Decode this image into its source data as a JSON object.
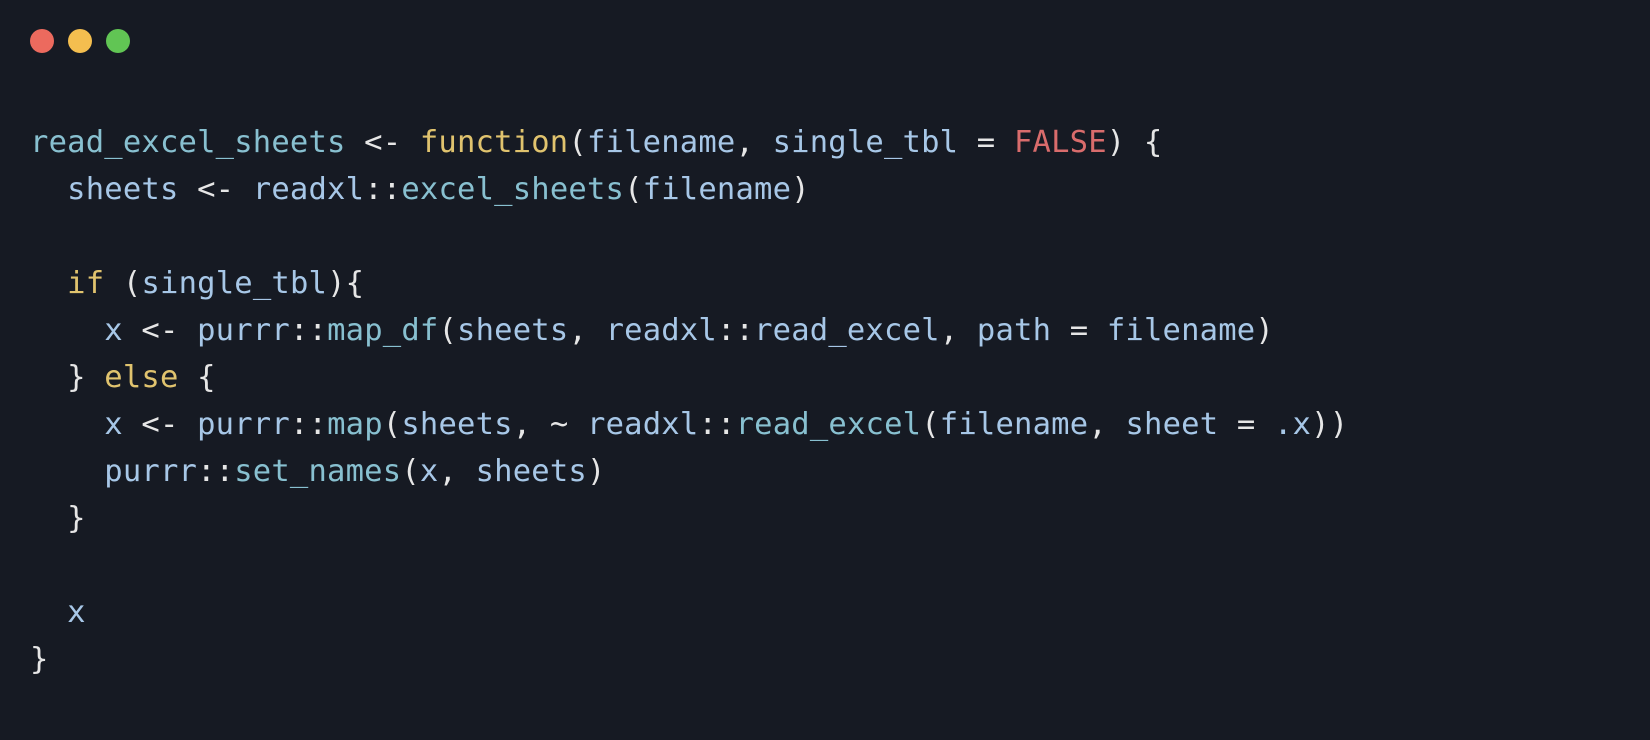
{
  "window_controls": {
    "close_color": "#ec6a5e",
    "min_color": "#f4be4f",
    "max_color": "#61c554"
  },
  "syntax_colors": {
    "bg": "#161a23",
    "fn": "#88c0d0",
    "kw": "#e0c36e",
    "id": "#a7c7e7",
    "op": "#e6e6e6",
    "bool": "#d96c6c"
  },
  "code": {
    "l1": {
      "fn_name": "read_excel_sheets",
      "assign": " <- ",
      "kw_function": "function",
      "lp": "(",
      "p1": "filename",
      "comma1": ", ",
      "p2": "single_tbl",
      "eq": " = ",
      "false": "FALSE",
      "rp_brace": ") {"
    },
    "l2": {
      "indent": "  ",
      "lhs": "sheets",
      "assign": " <- ",
      "pkg": "readxl",
      "dcolon": "::",
      "call": "excel_sheets",
      "lp": "(",
      "arg": "filename",
      "rp": ")"
    },
    "l3": "",
    "l4": {
      "indent": "  ",
      "kw_if": "if",
      "sp": " ",
      "lp": "(",
      "cond": "single_tbl",
      "rp_brace": "){"
    },
    "l5": {
      "indent": "    ",
      "lhs": "x",
      "assign": " <- ",
      "pkg": "purrr",
      "dcolon": "::",
      "call": "map_df",
      "lp": "(",
      "a1": "sheets",
      "c1": ", ",
      "pkg2": "readxl",
      "dcolon2": "::",
      "a2": "read_excel",
      "c2": ", ",
      "kw_path": "path",
      "eq": " = ",
      "a3": "filename",
      "rp": ")"
    },
    "l6": {
      "indent": "  ",
      "close": "}",
      "sp": " ",
      "kw_else": "else",
      "sp2": " ",
      "open": "{"
    },
    "l7": {
      "indent": "    ",
      "lhs": "x",
      "assign": " <- ",
      "pkg": "purrr",
      "dcolon": "::",
      "call": "map",
      "lp": "(",
      "a1": "sheets",
      "c1": ", ",
      "tilde": "~",
      "sp": " ",
      "pkg2": "readxl",
      "dcolon2": "::",
      "call2": "read_excel",
      "lp2": "(",
      "a2": "filename",
      "c2": ", ",
      "kw_sheet": "sheet",
      "eq": " = ",
      "dotx": ".x",
      "rp2": ")",
      "rp": ")"
    },
    "l8": {
      "indent": "    ",
      "pkg": "purrr",
      "dcolon": "::",
      "call": "set_names",
      "lp": "(",
      "a1": "x",
      "c1": ", ",
      "a2": "sheets",
      "rp": ")"
    },
    "l9": {
      "indent": "  ",
      "close": "}"
    },
    "l10": "",
    "l11": {
      "indent": "  ",
      "ret": "x"
    },
    "l12": {
      "close": "}"
    }
  }
}
